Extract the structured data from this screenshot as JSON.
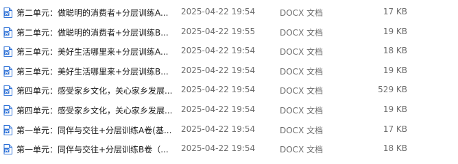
{
  "files": [
    {
      "name": "第二单元：做聪明的消费者+分层训练A...",
      "modified": "2025-04-22 19:54",
      "type": "DOCX 文档",
      "size": "17 KB",
      "icon": "word-doc-icon"
    },
    {
      "name": "第二单元：做聪明的消费者+分层训练B...",
      "modified": "2025-04-22 19:55",
      "type": "DOCX 文档",
      "size": "19 KB",
      "icon": "word-doc-icon"
    },
    {
      "name": "第三单元：美好生活哪里来+分层训练A...",
      "modified": "2025-04-22 19:54",
      "type": "DOCX 文档",
      "size": "18 KB",
      "icon": "word-doc-icon"
    },
    {
      "name": "第三单元：美好生活哪里来+分层训练B...",
      "modified": "2025-04-22 19:54",
      "type": "DOCX 文档",
      "size": "19 KB",
      "icon": "word-doc-icon"
    },
    {
      "name": "第四单元：感受家乡文化，关心家乡发展...",
      "modified": "2025-04-22 19:54",
      "type": "DOCX 文档",
      "size": "529 KB",
      "icon": "word-doc-icon"
    },
    {
      "name": "第四单元：感受家乡文化，关心家乡发展...",
      "modified": "2025-04-22 19:54",
      "type": "DOCX 文档",
      "size": "19 KB",
      "icon": "word-doc-icon"
    },
    {
      "name": "第一单元：同伴与交往+分层训练A卷(基...",
      "modified": "2025-04-22 19:54",
      "type": "DOCX 文档",
      "size": "17 KB",
      "icon": "word-doc-icon"
    },
    {
      "name": "第一单元：同伴与交往+分层训练B卷（...",
      "modified": "2025-04-22 19:54",
      "type": "DOCX 文档",
      "size": "18 KB",
      "icon": "word-doc-icon"
    }
  ],
  "colors": {
    "icon_blue": "#2b6fd6",
    "icon_fold": "#a9c6f3",
    "text_primary": "#1a1a1a",
    "text_secondary": "#6d6d6d"
  }
}
